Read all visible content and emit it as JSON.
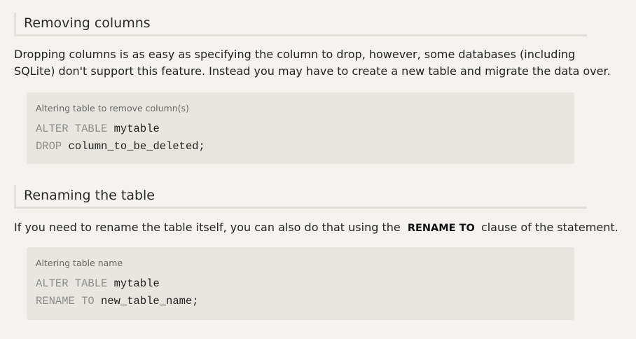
{
  "sections": [
    {
      "heading": "Removing columns",
      "paragraph": "Dropping columns is as easy as specifying the column to drop, however, some databases (including SQLite) don't support this feature. Instead you may have to create a new table and migrate the data over.",
      "code": {
        "caption": "Altering table to remove column(s)",
        "line1_kw": "ALTER TABLE",
        "line1_rest": " mytable",
        "line2_kw": "DROP",
        "line2_rest": " column_to_be_deleted;"
      }
    },
    {
      "heading": "Renaming the table",
      "paragraph_before": "If you need to rename the table itself, you can also do that using the",
      "paragraph_keyword": "RENAME TO",
      "paragraph_after": "clause of the statement.",
      "code": {
        "caption": "Altering table name",
        "line1_kw": "ALTER TABLE",
        "line1_rest": " mytable",
        "line2_kw": "RENAME TO",
        "line2_rest": " new_table_name;"
      }
    }
  ]
}
